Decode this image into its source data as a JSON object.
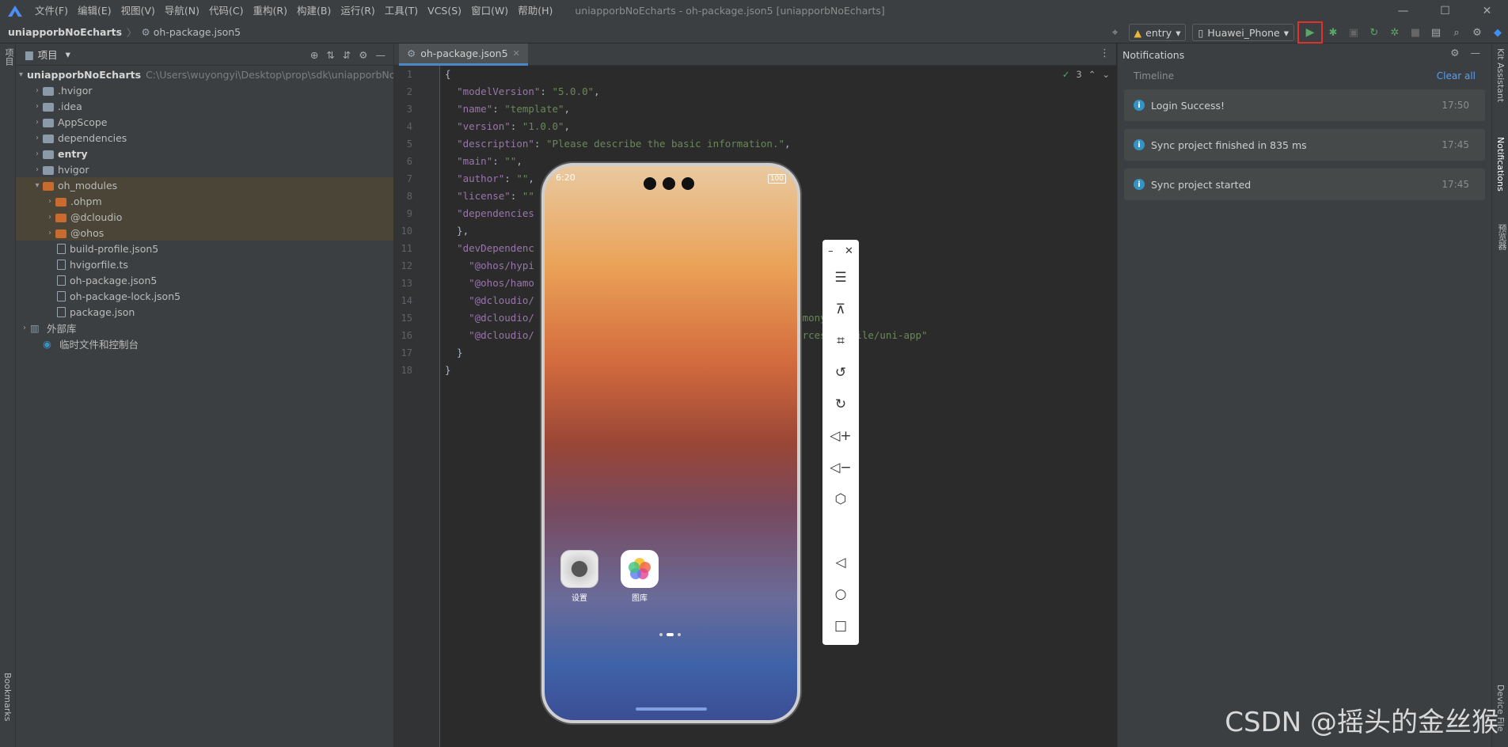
{
  "menu": [
    "文件(F)",
    "编辑(E)",
    "视图(V)",
    "导航(N)",
    "代码(C)",
    "重构(R)",
    "构建(B)",
    "运行(R)",
    "工具(T)",
    "VCS(S)",
    "窗口(W)",
    "帮助(H)"
  ],
  "window_title": "uniapporbNoEcharts - oh-package.json5 [uniapporbNoEcharts]",
  "breadcrumb": {
    "project": "uniapporbNoEcharts",
    "file": "oh-package.json5"
  },
  "toolbar": {
    "module": "entry",
    "device": "Huawei_Phone"
  },
  "left_strip": {
    "project_tab": "项目",
    "bookmarks_tab": "Bookmarks"
  },
  "project_panel": {
    "title": "项目",
    "tree": [
      {
        "name": "uniapporbNoEcharts",
        "path": "C:\\Users\\wuyongyi\\Desktop\\prop\\sdk\\uniapporbNo",
        "indent": 0,
        "arrow": "▾",
        "type": "root"
      },
      {
        "name": ".hvigor",
        "indent": 1,
        "arrow": "›",
        "type": "folder"
      },
      {
        "name": ".idea",
        "indent": 1,
        "arrow": "›",
        "type": "folder"
      },
      {
        "name": "AppScope",
        "indent": 1,
        "arrow": "›",
        "type": "folder"
      },
      {
        "name": "dependencies",
        "indent": 1,
        "arrow": "›",
        "type": "folder"
      },
      {
        "name": "entry",
        "indent": 1,
        "arrow": "›",
        "type": "folder-bold"
      },
      {
        "name": "hvigor",
        "indent": 1,
        "arrow": "›",
        "type": "folder"
      },
      {
        "name": "oh_modules",
        "indent": 1,
        "arrow": "▾",
        "type": "folder-orange"
      },
      {
        "name": ".ohpm",
        "indent": 2,
        "arrow": "›",
        "type": "folder-orange"
      },
      {
        "name": "@dcloudio",
        "indent": 2,
        "arrow": "›",
        "type": "folder-orange"
      },
      {
        "name": "@ohos",
        "indent": 2,
        "arrow": "›",
        "type": "folder-orange"
      },
      {
        "name": "build-profile.json5",
        "indent": 2,
        "arrow": "",
        "type": "file"
      },
      {
        "name": "hvigorfile.ts",
        "indent": 2,
        "arrow": "",
        "type": "file"
      },
      {
        "name": "oh-package.json5",
        "indent": 2,
        "arrow": "",
        "type": "file"
      },
      {
        "name": "oh-package-lock.json5",
        "indent": 2,
        "arrow": "",
        "type": "file"
      },
      {
        "name": "package.json",
        "indent": 2,
        "arrow": "",
        "type": "file"
      },
      {
        "name": "外部库",
        "indent": 0,
        "arrow": "›",
        "type": "lib"
      },
      {
        "name": "临时文件和控制台",
        "indent": 1,
        "arrow": "",
        "type": "scratch"
      }
    ]
  },
  "editor": {
    "tab": "oh-package.json5",
    "check_count": "3",
    "lines": [
      {
        "n": "1",
        "html": "{"
      },
      {
        "n": "2",
        "html": "  <span class='k'>\"modelVersion\"</span>: <span class='s'>\"5.0.0\"</span>,"
      },
      {
        "n": "3",
        "html": "  <span class='k'>\"name\"</span>: <span class='s'>\"template\"</span>,"
      },
      {
        "n": "4",
        "html": "  <span class='k'>\"version\"</span>: <span class='s'>\"1.0.0\"</span>,"
      },
      {
        "n": "5",
        "html": "  <span class='k'>\"description\"</span>: <span class='s'>\"Please describe the basic information.\"</span>,"
      },
      {
        "n": "6",
        "html": "  <span class='k'>\"main\"</span>: <span class='s'>\"\"</span>,"
      },
      {
        "n": "7",
        "html": "  <span class='k'>\"author\"</span>: <span class='s'>\"\"</span>,"
      },
      {
        "n": "8",
        "html": "  <span class='k'>\"license\"</span>: <span class='s'>\"\"</span>"
      },
      {
        "n": "9",
        "html": "  <span class='k'>\"dependencies</span>"
      },
      {
        "n": "10",
        "html": "  },"
      },
      {
        "n": "11",
        "html": "  <span class='k'>\"devDependenc</span>"
      },
      {
        "n": "12",
        "html": "    <span class='k'>\"@ohos/hypi</span>"
      },
      {
        "n": "13",
        "html": "    <span class='k'>\"@ohos/hamo</span>"
      },
      {
        "n": "14",
        "html": "    <span class='k'>\"@dcloudio/</span>"
      },
      {
        "n": "15",
        "html": "    <span class='k'>\"@dcloudio/</span>                                   <span class='s'>ni-app-harmony\"</span>,"
      },
      {
        "n": "16",
        "html": "    <span class='k'>\"@dcloudio/</span>                                   <span class='s'>main/resources/rawfile/uni-app\"</span>"
      },
      {
        "n": "17",
        "html": "  }"
      },
      {
        "n": "18",
        "html": "}"
      }
    ]
  },
  "phone": {
    "time": "6:20",
    "battery": "100",
    "apps": [
      {
        "label": "设置"
      },
      {
        "label": "图库"
      }
    ]
  },
  "emulator_tools": [
    "minimize-icon",
    "close-icon",
    "menu-icon",
    "pin-icon",
    "crop-icon",
    "rotate-left-icon",
    "rotate-right-icon",
    "volume-up-icon",
    "volume-down-icon",
    "shake-icon",
    "back-icon",
    "home-icon",
    "recents-icon"
  ],
  "notifications": {
    "title": "Notifications",
    "timeline_label": "Timeline",
    "clear_all": "Clear all",
    "items": [
      {
        "text": "Login Success!",
        "time": "17:50"
      },
      {
        "text": "Sync project finished in 835 ms",
        "time": "17:45"
      },
      {
        "text": "Sync project started",
        "time": "17:45"
      }
    ]
  },
  "right_strip": [
    "Kit Assistant",
    "Notifications",
    "预览器",
    "Device File"
  ],
  "watermark": "CSDN @摇头的金丝猴"
}
